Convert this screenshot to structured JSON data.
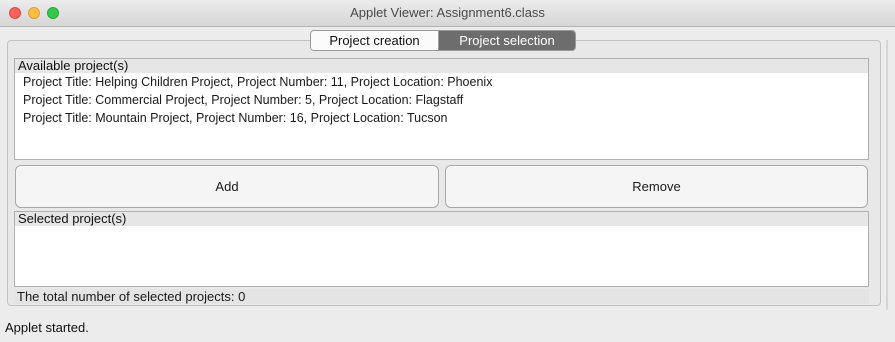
{
  "window": {
    "title": "Applet Viewer: Assignment6.class"
  },
  "tabs": [
    {
      "label": "Project creation",
      "active": false
    },
    {
      "label": "Project selection",
      "active": true
    }
  ],
  "available": {
    "header": "Available project(s)",
    "items": [
      "Project Title:  Helping Children Project, Project Number: 11, Project Location: Phoenix",
      "Project Title:  Commercial Project, Project Number: 5, Project Location: Flagstaff",
      "Project Title:  Mountain Project, Project Number: 16, Project Location: Tucson"
    ]
  },
  "buttons": {
    "add": "Add",
    "remove": "Remove"
  },
  "selected": {
    "header": "Selected project(s)",
    "items": []
  },
  "total_label": "The total number of selected projects: 0",
  "status": "Applet started.",
  "colors": {
    "active_tab": "#6d6d6d",
    "close": "#fc605c",
    "minimize": "#fdbc40",
    "maximize": "#34c84a"
  }
}
